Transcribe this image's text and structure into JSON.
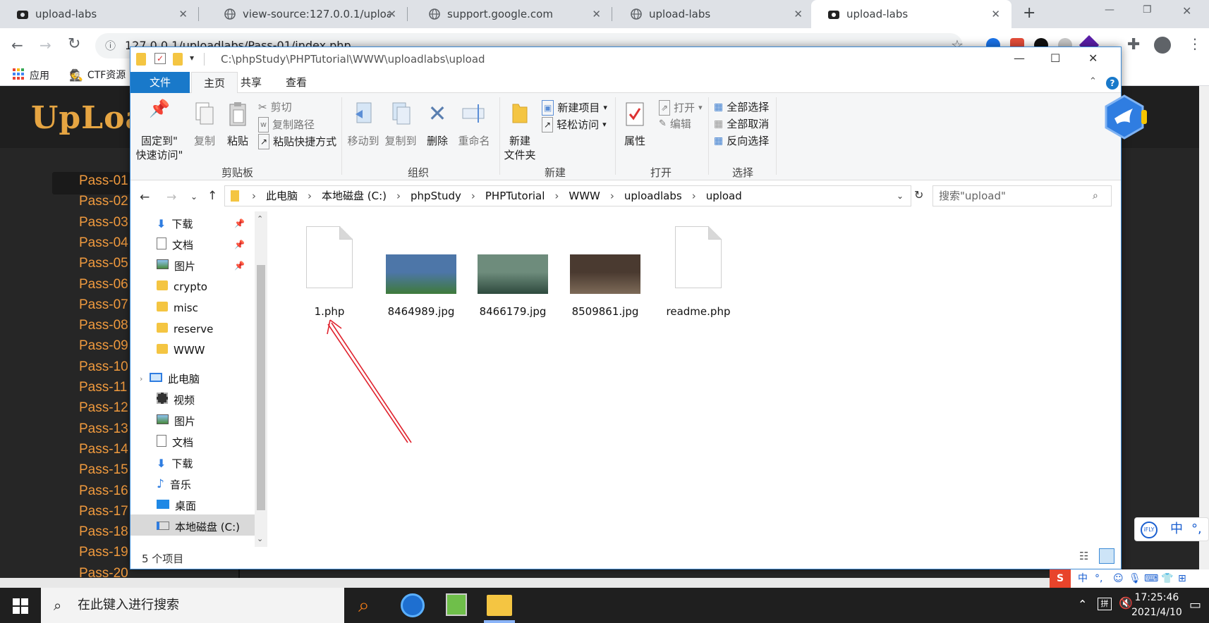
{
  "browser": {
    "tabs": [
      {
        "title": "upload-labs",
        "icon": "upload-labs-favicon"
      },
      {
        "title": "view-source:127.0.0.1/uploa",
        "icon": "globe-icon"
      },
      {
        "title": "support.google.com",
        "icon": "globe-icon"
      },
      {
        "title": "upload-labs",
        "icon": "globe-icon"
      },
      {
        "title": "upload-labs",
        "icon": "upload-labs-favicon",
        "active": true
      }
    ],
    "new_tab": "+",
    "address": "127.0.0.1/uploadlabs/Pass-01/index.php",
    "bookmarks": [
      {
        "label": "应用",
        "icon": "apps-grid-icon"
      },
      {
        "label": "CTF资源",
        "icon": "spy-icon"
      }
    ]
  },
  "webpage": {
    "logo": "UpLoad",
    "passes": [
      "Pass-01",
      "Pass-02",
      "Pass-03",
      "Pass-04",
      "Pass-05",
      "Pass-06",
      "Pass-07",
      "Pass-08",
      "Pass-09",
      "Pass-10",
      "Pass-11",
      "Pass-12",
      "Pass-13",
      "Pass-14",
      "Pass-15",
      "Pass-16",
      "Pass-17",
      "Pass-18",
      "Pass-19",
      "Pass-20"
    ],
    "selected_pass": "Pass-01"
  },
  "explorer": {
    "title_path": "C:\\phpStudy\\PHPTutorial\\WWW\\uploadlabs\\upload",
    "ribbon_tabs": [
      "文件",
      "主页",
      "共享",
      "查看"
    ],
    "active_ribbon_tab": "主页",
    "clipboard": {
      "pin": "固定到\"",
      "pin2": "快速访问\"",
      "copy": "复制",
      "paste": "粘贴",
      "cut": "剪切",
      "copy_path": "复制路径",
      "paste_shortcut": "粘贴快捷方式",
      "group": "剪贴板"
    },
    "organize": {
      "move_to": "移动到",
      "copy_to": "复制到",
      "delete": "删除",
      "rename": "重命名",
      "group": "组织"
    },
    "new": {
      "new_folder": "新建",
      "new_folder2": "文件夹",
      "new_item": "新建项目",
      "easy_access": "轻松访问",
      "group": "新建"
    },
    "open": {
      "properties": "属性",
      "open": "打开",
      "edit": "编辑",
      "group": "打开"
    },
    "select": {
      "select_all": "全部选择",
      "select_none": "全部取消",
      "invert": "反向选择",
      "group": "选择"
    },
    "breadcrumb": [
      "此电脑",
      "本地磁盘 (C:)",
      "phpStudy",
      "PHPTutorial",
      "WWW",
      "uploadlabs",
      "upload"
    ],
    "search_placeholder": "搜索\"upload\"",
    "nav_items": [
      {
        "label": "下载",
        "icon": "download-arrow-icon",
        "pinned": true
      },
      {
        "label": "文档",
        "icon": "document-icon",
        "pinned": true
      },
      {
        "label": "图片",
        "icon": "pictures-icon",
        "pinned": true
      },
      {
        "label": "crypto",
        "icon": "folder-icon"
      },
      {
        "label": "misc",
        "icon": "folder-icon"
      },
      {
        "label": "reserve",
        "icon": "folder-icon"
      },
      {
        "label": "WWW",
        "icon": "folder-icon"
      },
      {
        "label": "此电脑",
        "icon": "computer-icon"
      },
      {
        "label": "视频",
        "icon": "video-icon"
      },
      {
        "label": "图片",
        "icon": "pictures-icon"
      },
      {
        "label": "文档",
        "icon": "document-icon"
      },
      {
        "label": "下载",
        "icon": "download-arrow-icon"
      },
      {
        "label": "音乐",
        "icon": "music-note-icon"
      },
      {
        "label": "桌面",
        "icon": "desktop-icon"
      },
      {
        "label": "本地磁盘 (C:)",
        "icon": "drive-icon",
        "selected": true
      }
    ],
    "files": [
      {
        "name": "1.php",
        "type": "doc"
      },
      {
        "name": "8464989.jpg",
        "type": "image",
        "colors": [
          "#4d76a8",
          "#3f7a3a"
        ]
      },
      {
        "name": "8466179.jpg",
        "type": "image",
        "colors": [
          "#6e8c7c",
          "#2e4a3e"
        ]
      },
      {
        "name": "8509861.jpg",
        "type": "image",
        "colors": [
          "#4a3a30",
          "#7d6a58"
        ]
      },
      {
        "name": "readme.php",
        "type": "doc"
      }
    ],
    "status": "5 个项目"
  },
  "taskbar": {
    "search_placeholder": "在此键入进行搜索",
    "time": "17:25:46",
    "date": "2021/4/10"
  },
  "ime": {
    "label": "中",
    "punct": "°,"
  },
  "colors": {
    "accent": "#1979ca",
    "pass_orange": "#f09a3e",
    "arrow_red": "#e0232e"
  }
}
